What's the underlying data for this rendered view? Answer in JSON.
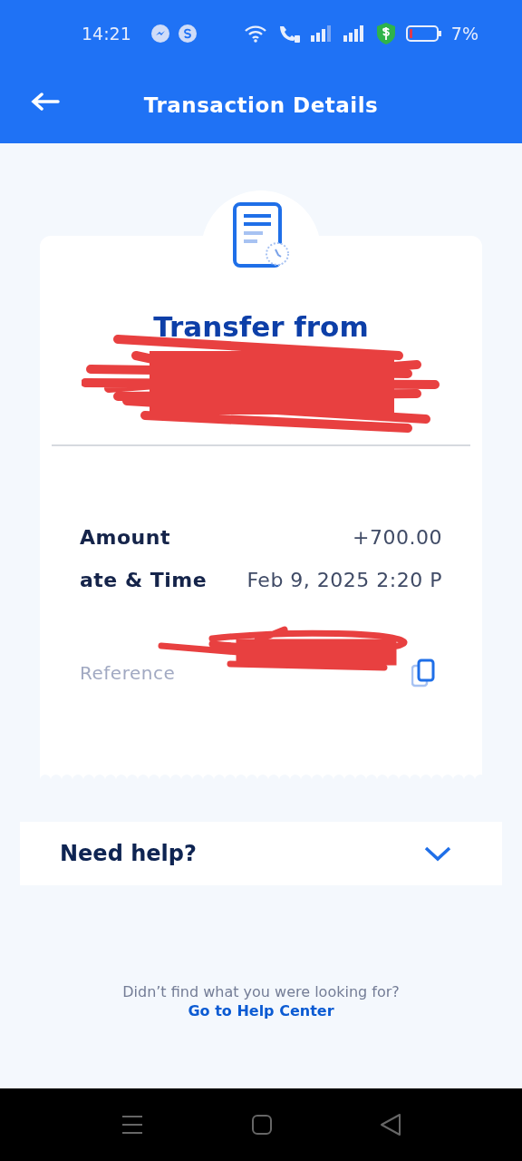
{
  "status_bar": {
    "time": "14:21",
    "battery": "7%"
  },
  "header": {
    "title": "Transaction Details"
  },
  "transaction": {
    "title": "Transfer from",
    "rows": [
      {
        "label": "Amount",
        "value": "+700.00"
      },
      {
        "label": "ate & Time",
        "value": "Feb 9, 2025 2:20 P"
      }
    ],
    "reference": {
      "label": "Reference"
    }
  },
  "help": {
    "title": "Need help?",
    "expanded": false
  },
  "footer": {
    "text": "Didn’t find what you were looking for?",
    "link": "Go to Help Center"
  }
}
